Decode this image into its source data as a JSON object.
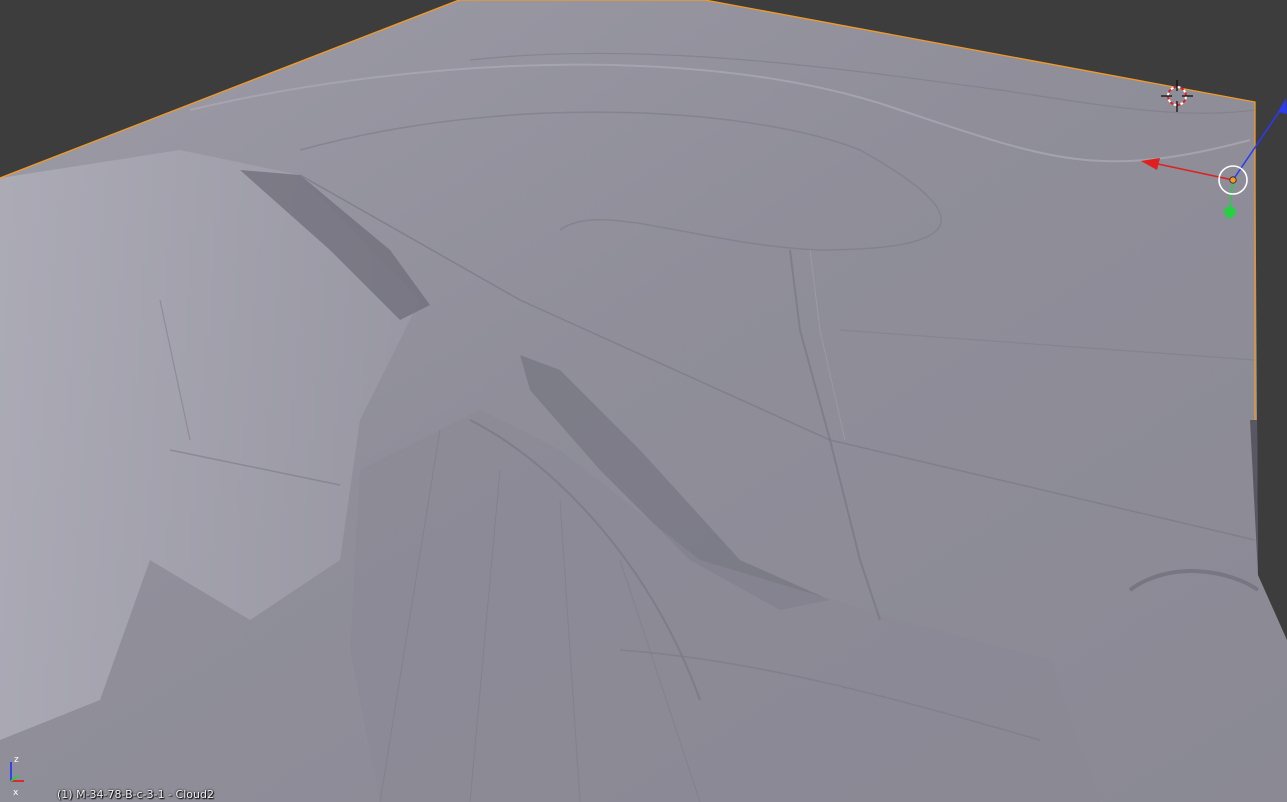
{
  "viewport": {
    "object_label": "(1) M-34-78-B-c-3-1 - Cloud2",
    "background_color": "#3d3d3d",
    "selection_outline_color": "#f39a25",
    "terrain_color": "#8e8d98"
  },
  "icons": {
    "cursor": "3d-cursor-icon",
    "manipulator": "transform-manipulator-icon",
    "axis_gizmo": "axis-orientation-icon"
  }
}
